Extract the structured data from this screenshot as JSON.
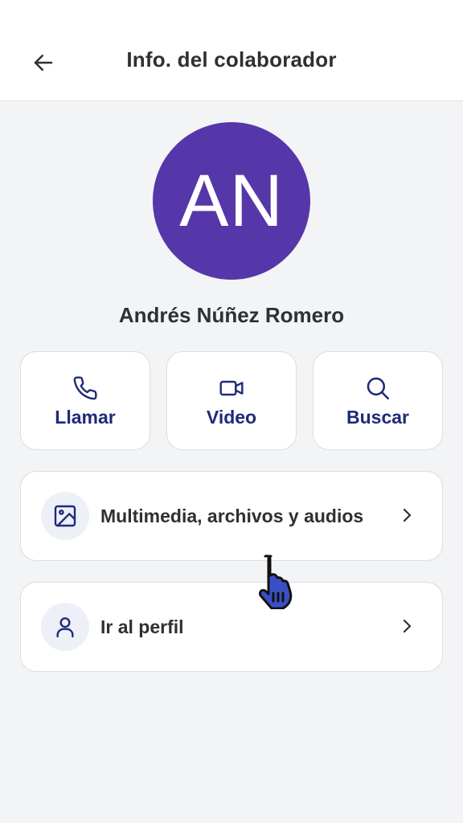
{
  "header": {
    "title": "Info. del colaborador",
    "back_icon": "arrow-left-icon"
  },
  "profile": {
    "initials": "AN",
    "name": "Andrés Núñez Romero",
    "avatar_color": "#5637a9"
  },
  "actions": [
    {
      "label": "Llamar",
      "icon": "phone-icon"
    },
    {
      "label": "Video",
      "icon": "video-camera-icon"
    },
    {
      "label": "Buscar",
      "icon": "search-icon"
    }
  ],
  "list": [
    {
      "label": "Multimedia, archivos y audios",
      "icon": "image-icon"
    },
    {
      "label": "Ir al perfil",
      "icon": "user-icon"
    }
  ],
  "colors": {
    "accent": "#1f2a7a",
    "background": "#f3f4f6",
    "card": "#ffffff"
  }
}
